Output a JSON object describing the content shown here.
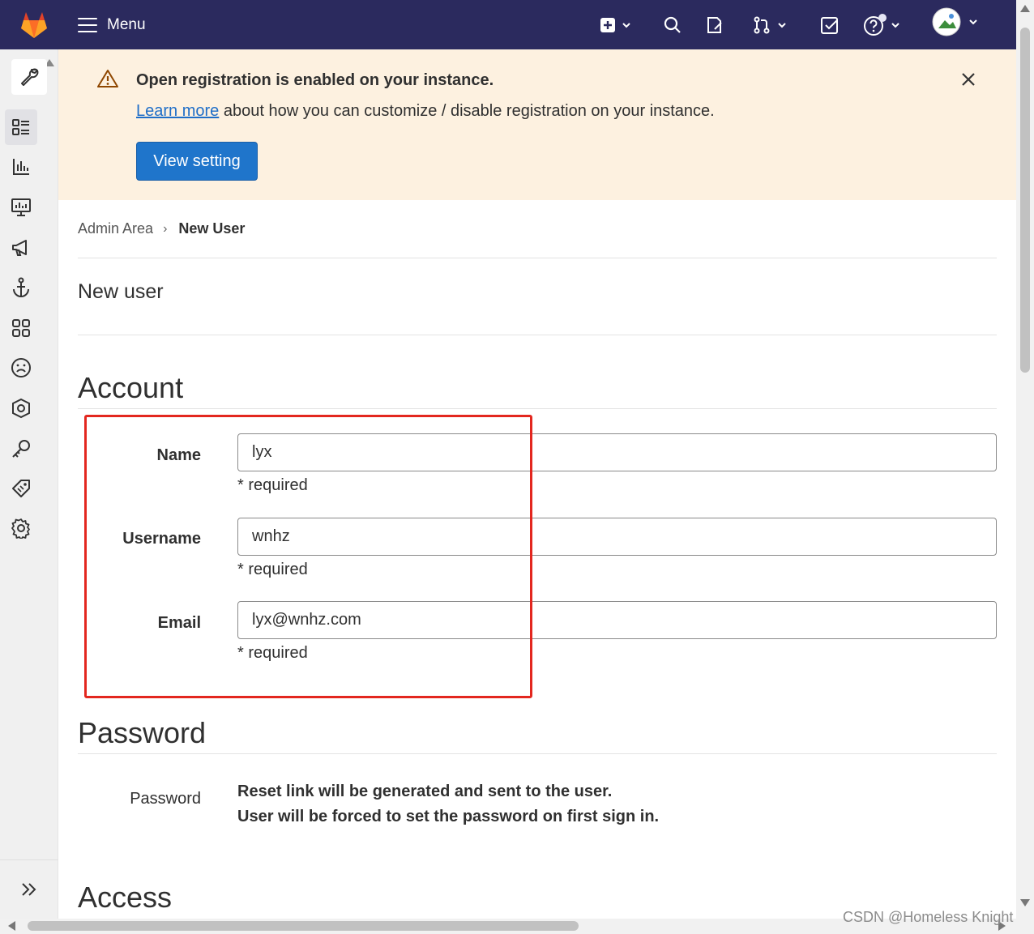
{
  "navbar": {
    "menu_label": "Menu"
  },
  "alert": {
    "title": "Open registration is enabled on your instance.",
    "link_text": "Learn more",
    "body_rest": " about how you can customize / disable registration on your instance.",
    "button_label": "View setting"
  },
  "breadcrumb": {
    "parent": "Admin Area",
    "current": "New User"
  },
  "page": {
    "title": "New user"
  },
  "account": {
    "heading": "Account",
    "fields": [
      {
        "label": "Name",
        "value": "lyx",
        "hint": "* required"
      },
      {
        "label": "Username",
        "value": "wnhz",
        "hint": "* required"
      },
      {
        "label": "Email",
        "value": "lyx@wnhz.com",
        "hint": "* required"
      }
    ]
  },
  "password": {
    "heading": "Password",
    "label": "Password",
    "line1": "Reset link will be generated and sent to the user.",
    "line2": "User will be forced to set the password on first sign in."
  },
  "access": {
    "heading": "Access"
  },
  "watermark": "CSDN @Homeless Knight",
  "colors": {
    "navbar": "#2b2a5e",
    "alert_bg": "#fdf1e0",
    "primary_button": "#1f75cb",
    "annotation": "#e3271f"
  },
  "icons": {
    "sidebar": [
      "wrench-icon",
      "overview-icon",
      "analytics-icon",
      "monitoring-icon",
      "messages-icon",
      "hooks-icon",
      "applications-icon",
      "abuse-reports-icon",
      "kubernetes-icon",
      "deploy-keys-icon",
      "labels-icon",
      "settings-icon"
    ],
    "navbar": [
      "gitlab-logo",
      "create-new-icon",
      "search-icon",
      "issues-icon",
      "merge-requests-icon",
      "todos-icon",
      "help-icon",
      "avatar"
    ]
  }
}
